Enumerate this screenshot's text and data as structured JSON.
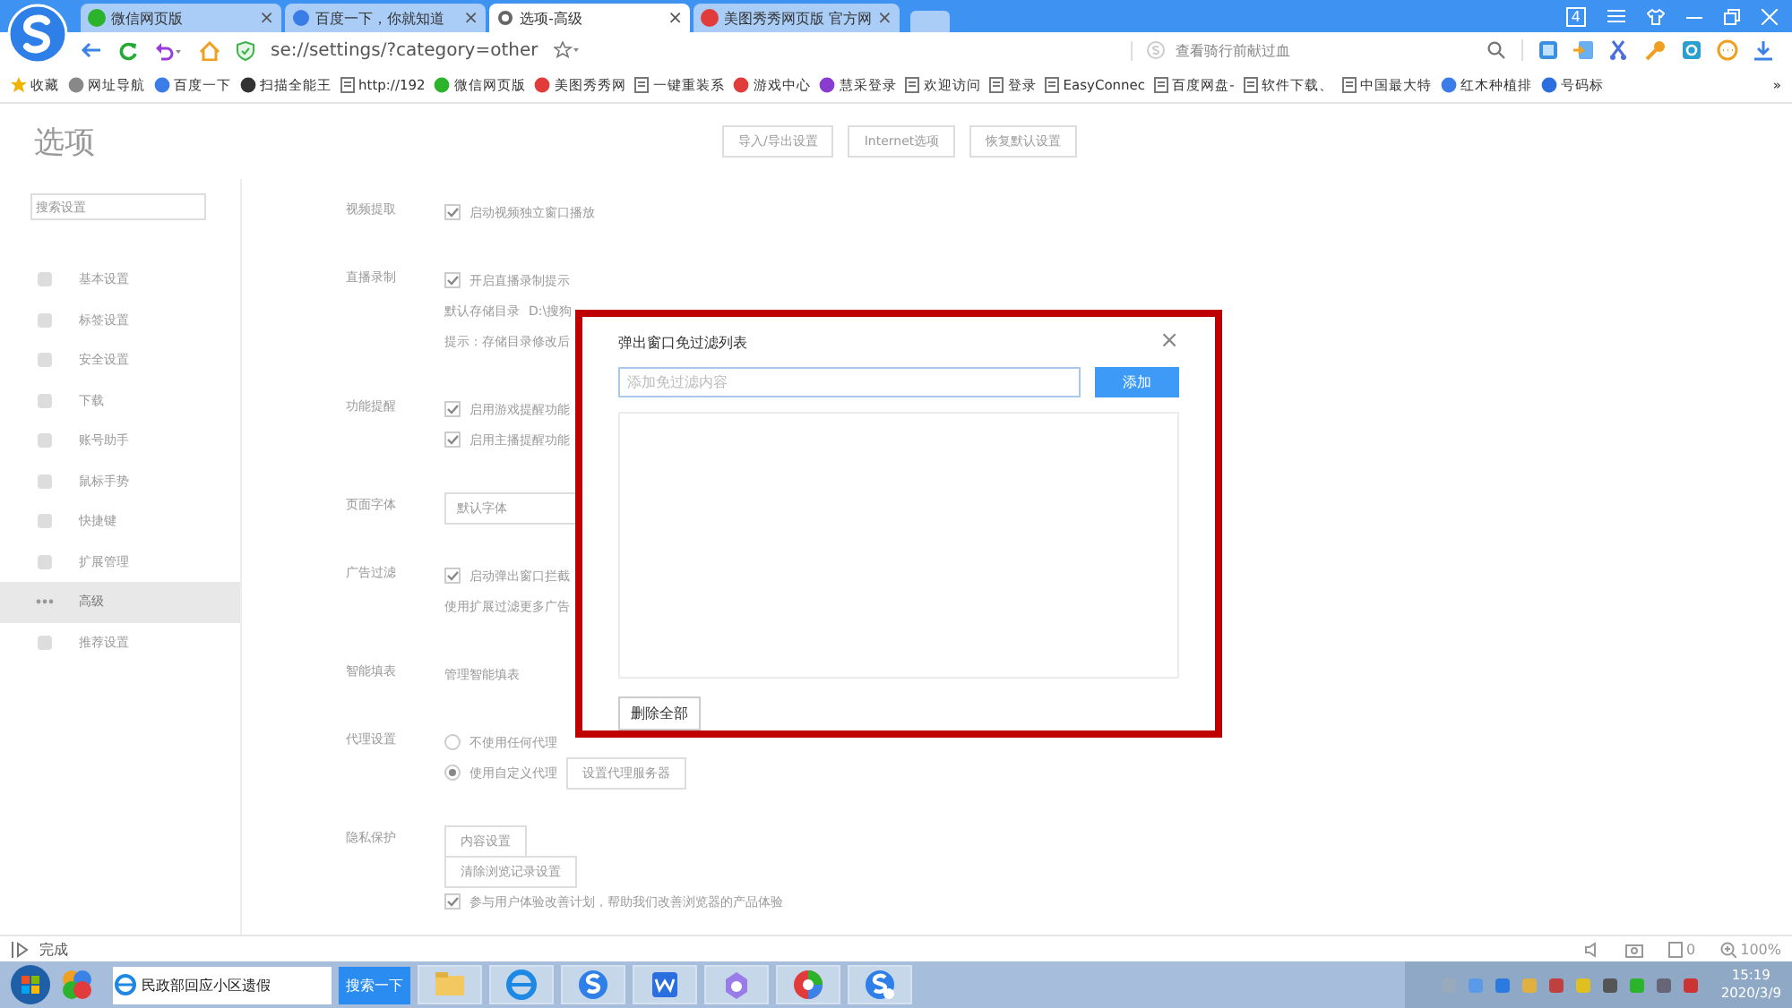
{
  "browser": {
    "tabs": [
      {
        "label": "微信网页版",
        "selected": false,
        "close": "×"
      },
      {
        "label": "百度一下，你就知道",
        "selected": false,
        "close": "×"
      },
      {
        "label": "选项-高级",
        "selected": true,
        "close": "×"
      },
      {
        "label": "美图秀秀网页版 官方网",
        "selected": false,
        "close": "×"
      }
    ],
    "tab_count": "4",
    "address": "se://settings/?category=other",
    "search": {
      "placeholder": "查看骑行前献过血"
    },
    "bookmarks": [
      "收藏",
      "网址导航",
      "百度一下",
      "扫描全能王",
      "http://192",
      "微信网页版",
      "美图秀秀网",
      "一键重装系",
      "游戏中心",
      "慧采登录",
      "欢迎访问",
      "登录",
      "EasyConnec",
      "百度网盘-",
      "软件下载、",
      "中国最大特",
      "红木种植排",
      "号码标"
    ],
    "more": "»"
  },
  "settings": {
    "title": "选项",
    "top_buttons": [
      "导入/导出设置",
      "Internet选项",
      "恢复默认设置"
    ],
    "search": {
      "placeholder": "搜索设置"
    },
    "sidebar": [
      {
        "label": "基本设置",
        "selected": false
      },
      {
        "label": "标签设置",
        "selected": false
      },
      {
        "label": "安全设置",
        "selected": false
      },
      {
        "label": "下载",
        "selected": false
      },
      {
        "label": "账号助手",
        "selected": false
      },
      {
        "label": "鼠标手势",
        "selected": false
      },
      {
        "label": "快捷键",
        "selected": false
      },
      {
        "label": "扩展管理",
        "selected": false
      },
      {
        "label": "高级",
        "selected": true
      },
      {
        "label": "推荐设置",
        "selected": false
      }
    ],
    "sections": [
      {
        "label": "视频提取",
        "items": [
          {
            "kind": "checkbox",
            "text": "启动视频独立窗口播放",
            "checked": true
          }
        ]
      },
      {
        "label": "直播录制",
        "items": [
          {
            "kind": "checkbox",
            "text": "开启直播录制提示",
            "checked": true
          },
          {
            "kind": "path",
            "text": "默认存储目录",
            "value": "D:\\搜狗"
          },
          {
            "kind": "note",
            "text": "提示：存储目录修改后"
          }
        ]
      },
      {
        "label": "功能提醒",
        "items": [
          {
            "kind": "checkbox",
            "text": "启用游戏提醒功能",
            "checked": true
          },
          {
            "kind": "checkbox",
            "text": "启用主播提醒功能",
            "checked": true
          }
        ]
      },
      {
        "label": "页面字体",
        "items": [
          {
            "kind": "select",
            "text": "默认字体"
          }
        ]
      },
      {
        "label": "广告过滤",
        "items": [
          {
            "kind": "checkbox",
            "text": "启动弹出窗口拦截",
            "checked": true
          },
          {
            "kind": "note",
            "text": "使用扩展过滤更多广告"
          }
        ]
      },
      {
        "label": "智能填表",
        "items": [
          {
            "kind": "link",
            "text": "管理智能填表"
          }
        ]
      },
      {
        "label": "代理设置",
        "items": [
          {
            "kind": "radio",
            "text": "不使用任何代理",
            "selected": false
          },
          {
            "kind": "radio",
            "text": "使用自定义代理",
            "selected": true,
            "button": "设置代理服务器"
          }
        ]
      },
      {
        "label": "隐私保护",
        "items": [
          {
            "kind": "button",
            "text": "内容设置"
          },
          {
            "kind": "button",
            "text": "清除浏览记录设置"
          },
          {
            "kind": "checkbox",
            "text": "参与用户体验改善计划，帮助我们改善浏览器的产品体验",
            "checked": true
          }
        ]
      }
    ]
  },
  "dialog": {
    "title": "弹出窗口免过滤列表",
    "close": "×",
    "input": {
      "placeholder": "添加免过滤内容"
    },
    "add_button": "添加",
    "delete_all_button": "删除全部"
  },
  "status_bar": {
    "text": "完成",
    "count": "0",
    "zoom": "100%"
  },
  "taskbar": {
    "search": {
      "value": "民政部回应小区遗假"
    },
    "search_button": "搜索一下",
    "time": "15:19",
    "date": "2020/3/9"
  }
}
